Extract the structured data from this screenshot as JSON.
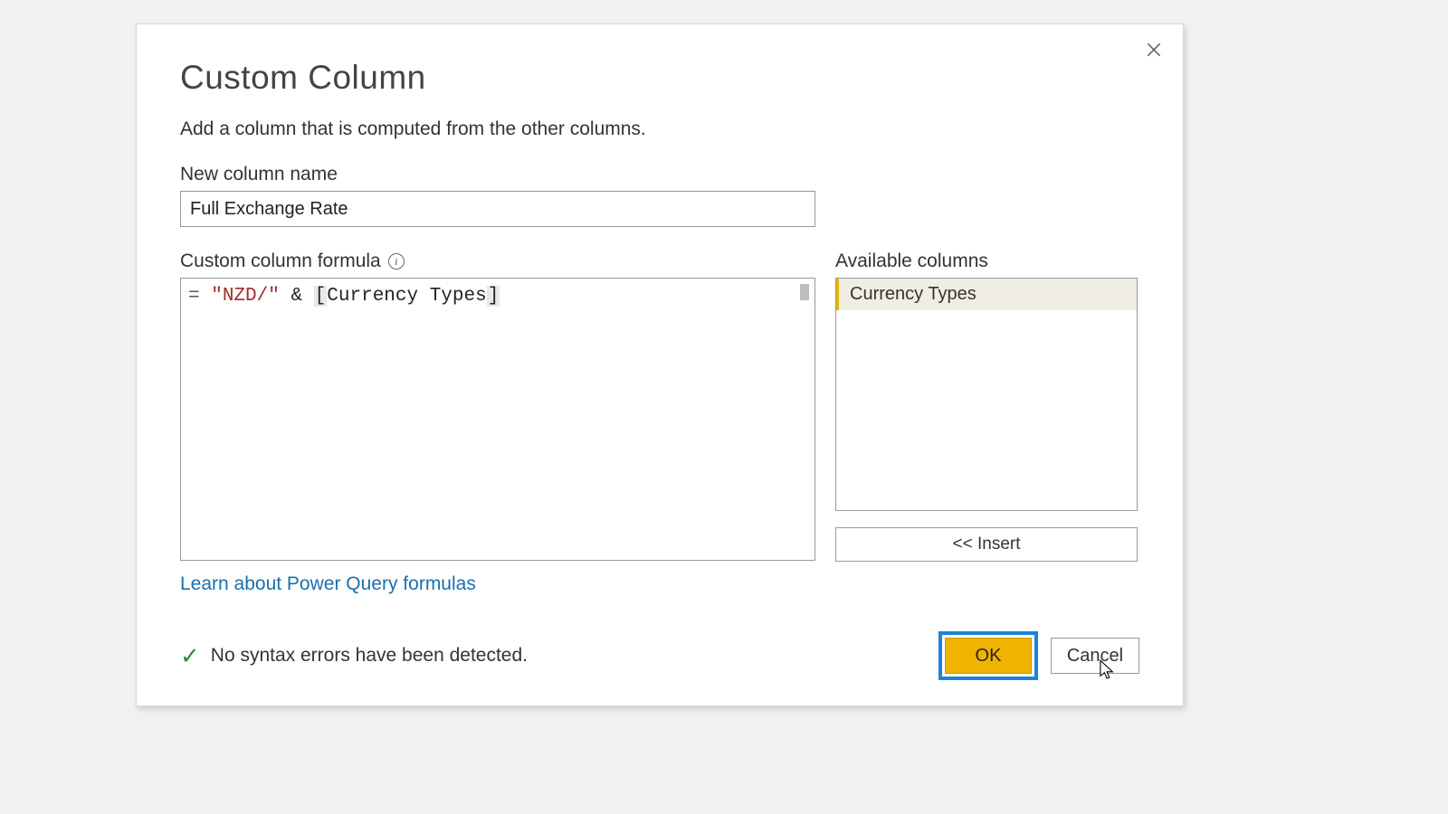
{
  "dialog": {
    "title": "Custom Column",
    "subtitle": "Add a column that is computed from the other columns.",
    "nameLabel": "New column name",
    "nameValue": "Full Exchange Rate",
    "formulaLabel": "Custom column formula",
    "formula": {
      "raw": "= \"NZD/\" & [Currency Types]",
      "eq": "= ",
      "string": "\"NZD/\"",
      "sp1": " ",
      "op": "&",
      "sp2": " ",
      "br_open": "[",
      "col_ref": "Currency Types",
      "br_close": "]"
    },
    "availableLabel": "Available columns",
    "availableColumns": [
      "Currency Types"
    ],
    "insertLabel": "<< Insert",
    "learnLink": "Learn about Power Query formulas",
    "status": "No syntax errors have been detected.",
    "okLabel": "OK",
    "cancelLabel": "Cancel"
  }
}
